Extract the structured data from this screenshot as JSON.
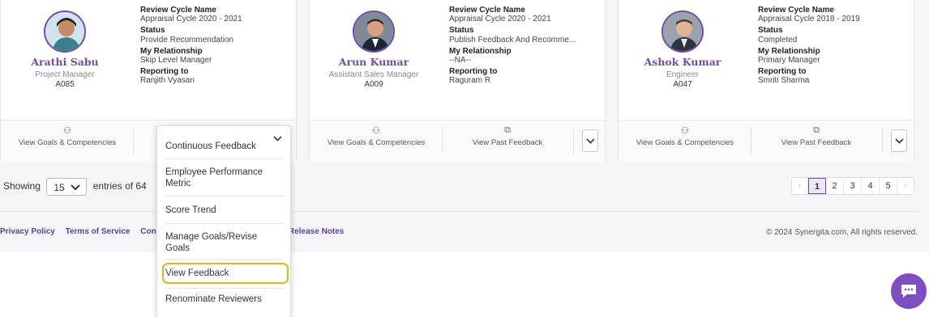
{
  "cards": [
    {
      "name": "Arathi Sabu",
      "designation": "Project Manager",
      "code": "A085",
      "review_cycle_label": "Review Cycle Name",
      "review_cycle": "Appraisal Cycle 2020 - 2021",
      "status_label": "Status",
      "status": "Provide Recommendation",
      "relationship_label": "My Relationship",
      "relationship": "Skip Level Manager",
      "reporting_label": "Reporting to",
      "reporting_to": "Ranjith Vyasan",
      "action1": "View Goals & Competencies"
    },
    {
      "name": "Arun Kumar",
      "designation": "Assistant Sales Manager",
      "code": "A009",
      "review_cycle_label": "Review Cycle Name",
      "review_cycle": "Appraisal Cycle 2020 - 2021",
      "status_label": "Status",
      "status": "Publish Feedback And Recomme...",
      "relationship_label": "My Relationship",
      "relationship": "--NA--",
      "reporting_label": "Reporting to",
      "reporting_to": "Raguram R",
      "action1": "View Goals & Competencies",
      "action2": "View Past Feedback"
    },
    {
      "name": "Ashok Kumar",
      "designation": "Engineer",
      "code": "A047",
      "review_cycle_label": "Review Cycle Name",
      "review_cycle": "Appraisal Cycle 2018 - 2019",
      "status_label": "Status",
      "status": "Completed",
      "relationship_label": "My Relationship",
      "relationship": "Primary Manager",
      "reporting_label": "Reporting to",
      "reporting_to": "Smriti Sharma",
      "action1": "View Goals & Competencies",
      "action2": "View Past Feedback"
    }
  ],
  "pagination": {
    "showing_label": "Showing",
    "page_size": "15",
    "entries_label": "entries of 64",
    "pages": [
      "1",
      "2",
      "3",
      "4",
      "5"
    ],
    "current_page": "1",
    "prev": "‹",
    "next": "›"
  },
  "footer": {
    "privacy": "Privacy Policy",
    "terms": "Terms of Service",
    "contact_partial": "Cont",
    "release_notes": "Release Notes",
    "copyright": "© 2024 Synergita.com. All rights reserved."
  },
  "dropdown_menu": {
    "items": [
      "Continuous Feedback",
      "Employee Performance Metric",
      "Score Trend",
      "Manage Goals/Revise Goals",
      "View Feedback",
      "Renominate Reviewers"
    ],
    "highlighted": "View Feedback"
  },
  "colors": {
    "accent": "#6b4ea8",
    "highlight": "#e7b416",
    "chat": "#7b4fc2"
  },
  "icons": {
    "goals": "goals-icon",
    "feedback": "feedback-icon",
    "dropdown": "chevron-down-icon",
    "chat": "chat-icon"
  }
}
